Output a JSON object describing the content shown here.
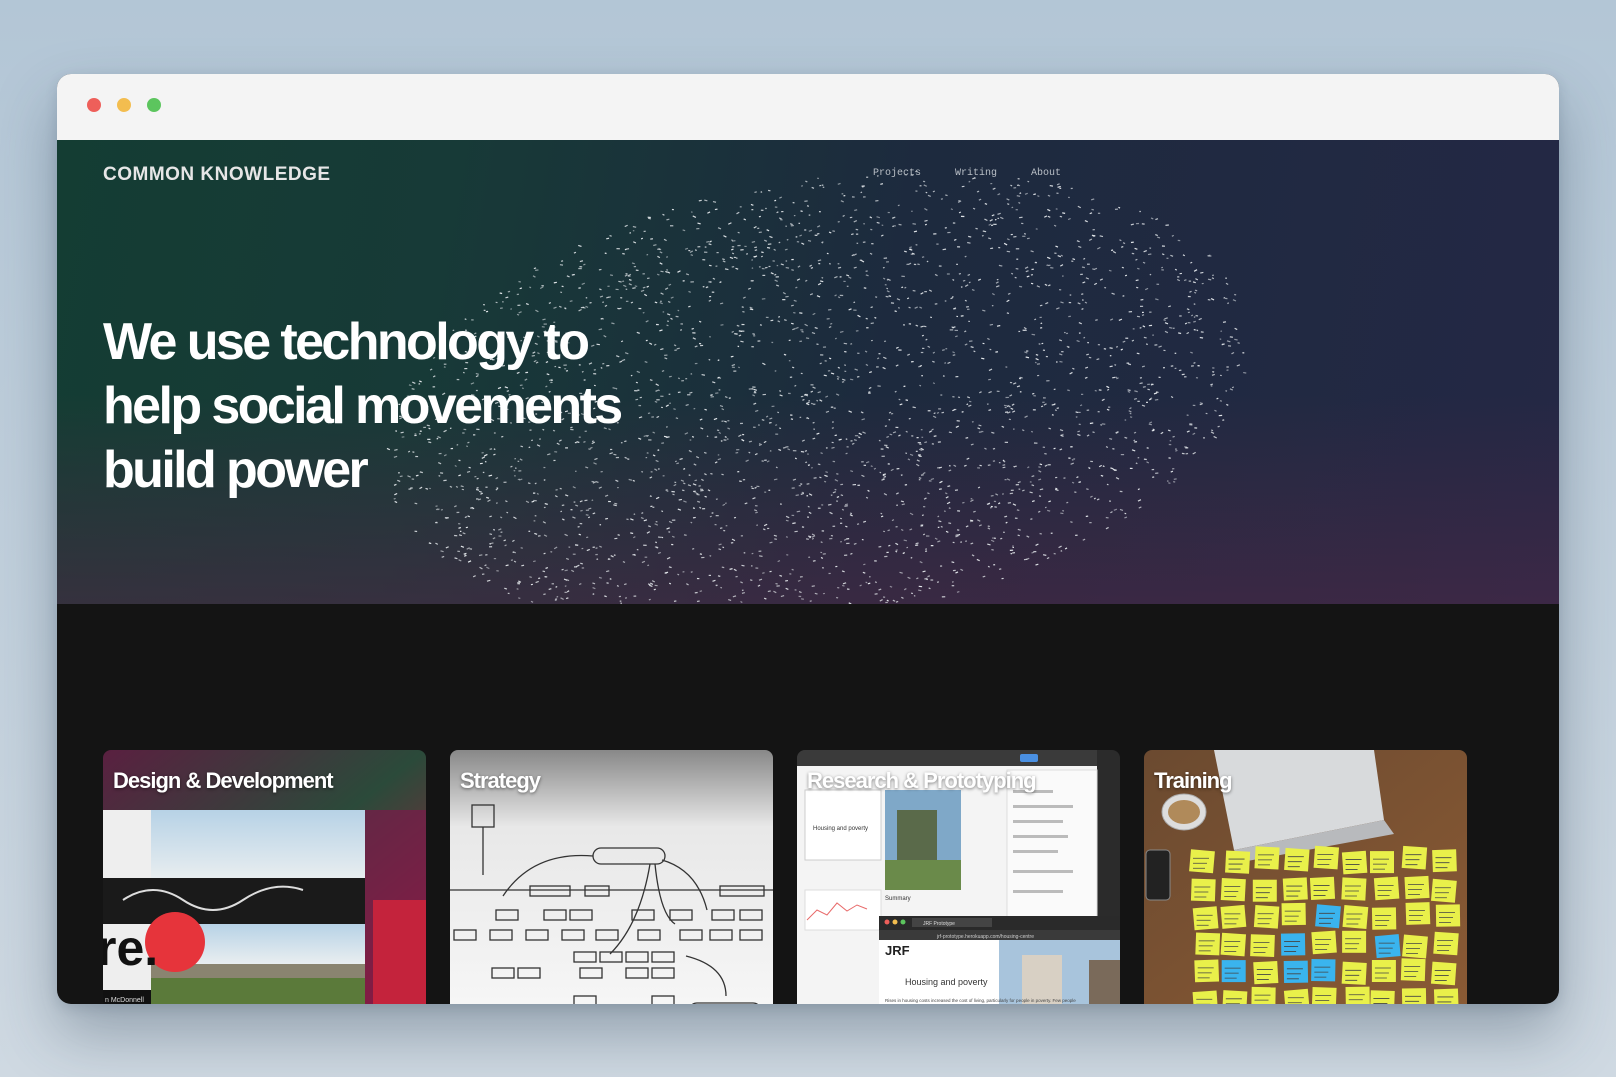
{
  "brand": "COMMON KNOWLEDGE",
  "nav": [
    "Projects",
    "Writing",
    "About"
  ],
  "headline": "We use technology to help social movements build power",
  "cards": [
    {
      "title": "Design & Development"
    },
    {
      "title": "Strategy"
    },
    {
      "title": "Research & Prototyping"
    },
    {
      "title": "Training"
    }
  ],
  "card_images": {
    "design_logo_text": "re.",
    "design_caption": "n McDonnell",
    "research_doc_title": "Housing and poverty",
    "research_summary": "Summary",
    "research_jrf": "JRF",
    "research_url": "jrf-prototype.herokuapp.com/housing-centre",
    "research_tab": "JRF Prototype",
    "research_body": "Rises in housing costs increased the cost of living, particularly for people in poverty. Few people"
  },
  "colors": {
    "hero_green": "#143d33",
    "hero_navy": "#242845",
    "page_dark": "#141414"
  }
}
